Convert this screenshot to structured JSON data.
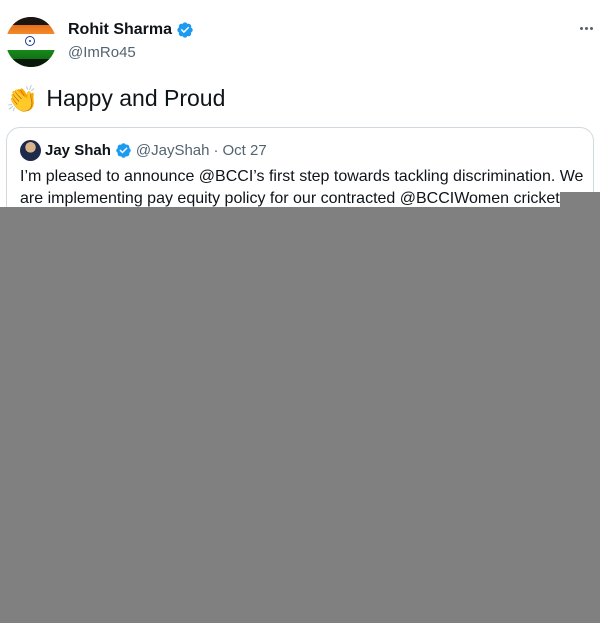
{
  "author": {
    "display_name": "Rohit Sharma",
    "handle": "@ImRo45",
    "verified_icon": "verified-badge-icon"
  },
  "tweet": {
    "emoji": "👏",
    "text": "Happy and Proud"
  },
  "quoted_tweet": {
    "display_name": "Jay Shah",
    "handle": "@JayShah",
    "separator": "·",
    "date": "Oct 27",
    "body": "I’m pleased to announce @BCCI’s first step towards tackling discrimination. We are implementing pay equity policy for our contracted @BCCIWomen cricketers"
  },
  "colors": {
    "verified": "#1d9bf0",
    "secondary_text": "#536471",
    "overlay": "#808080"
  }
}
